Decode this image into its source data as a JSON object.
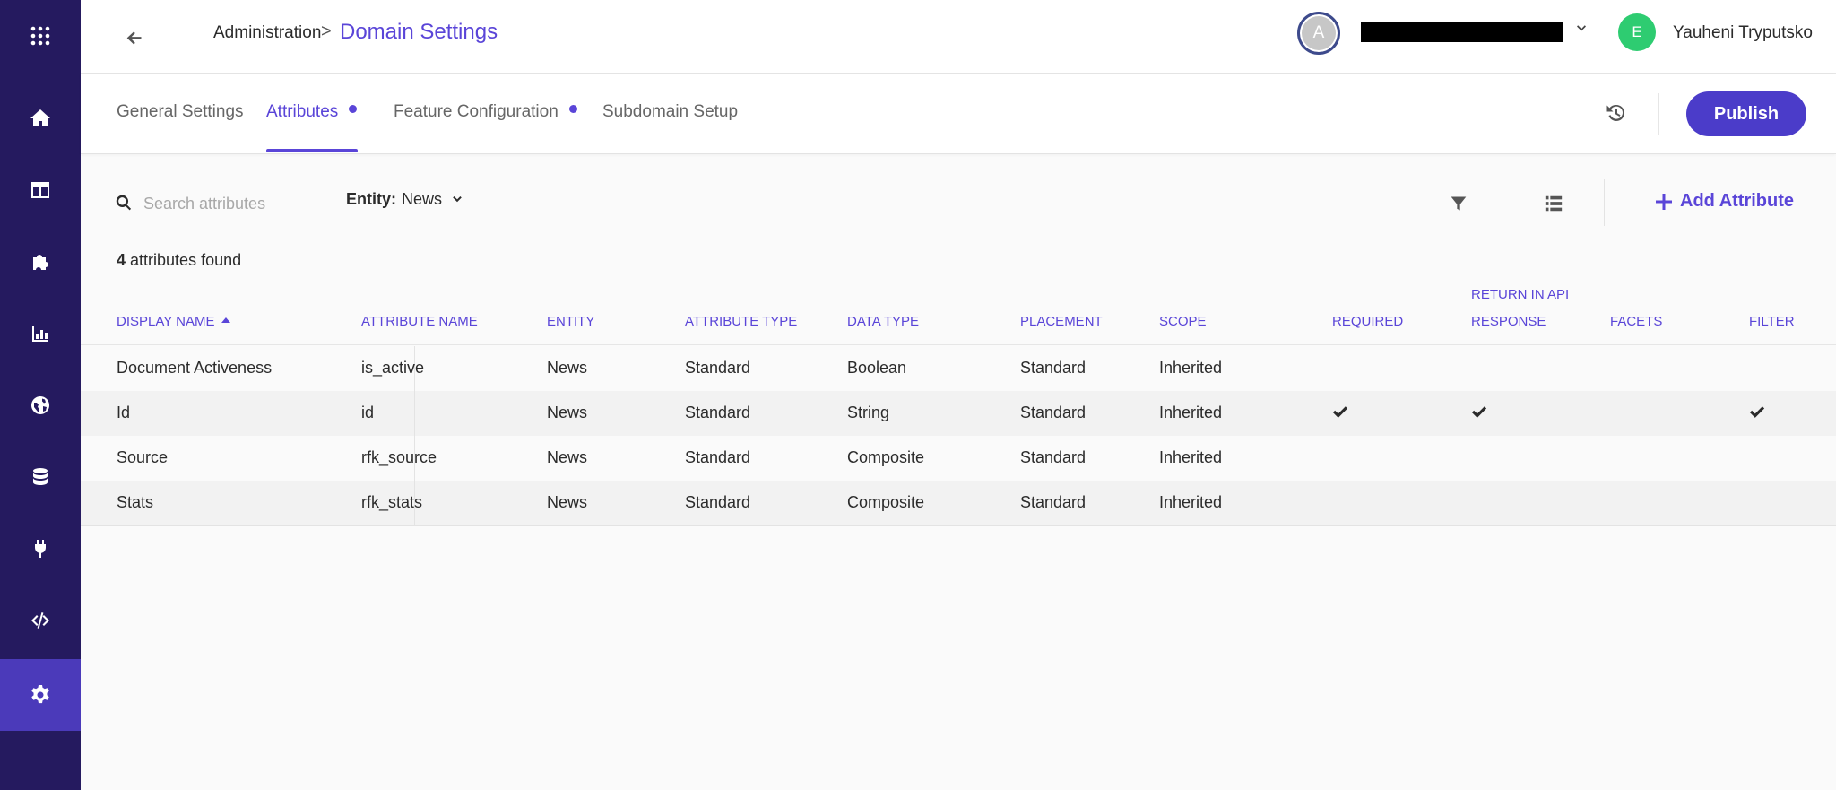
{
  "sidebar": {
    "items": [
      {
        "name": "apps-grid-icon"
      },
      {
        "name": "home-icon"
      },
      {
        "name": "layout-icon"
      },
      {
        "name": "puzzle-icon"
      },
      {
        "name": "analytics-icon"
      },
      {
        "name": "globe-icon"
      },
      {
        "name": "database-icon"
      },
      {
        "name": "plug-icon"
      },
      {
        "name": "code-icon"
      },
      {
        "name": "gear-icon",
        "active": true
      }
    ]
  },
  "header": {
    "breadcrumb_parent": "Administration",
    "breadcrumb_separator": ">",
    "page_title": "Domain Settings",
    "account_initial": "A",
    "user_initial": "E",
    "user_name": "Yauheni Tryputsko"
  },
  "tabs": [
    {
      "label": "General Settings",
      "active": false,
      "dot": false
    },
    {
      "label": "Attributes",
      "active": true,
      "dot": true
    },
    {
      "label": "Feature Configuration",
      "active": false,
      "dot": true
    },
    {
      "label": "Subdomain Setup",
      "active": false,
      "dot": false
    }
  ],
  "actions": {
    "publish_label": "Publish",
    "add_label": "Add Attribute"
  },
  "toolbar": {
    "search_placeholder": "Search attributes",
    "entity_label": "Entity:",
    "entity_value": "News"
  },
  "results": {
    "count": "4",
    "suffix": "attributes found"
  },
  "table": {
    "columns": [
      "Display Name",
      "Attribute Name",
      "Entity",
      "Attribute Type",
      "Data Type",
      "Placement",
      "Scope",
      "Required",
      "Return in API",
      "Response",
      "Facets",
      "Filter"
    ],
    "rows": [
      {
        "display_name": "Document Activeness",
        "attribute_name": "is_active",
        "entity": "News",
        "attribute_type": "Standard",
        "data_type": "Boolean",
        "placement": "Standard",
        "scope": "Inherited",
        "required": false,
        "return_in_api": false,
        "facets": false,
        "filter": false
      },
      {
        "display_name": "Id",
        "attribute_name": "id",
        "entity": "News",
        "attribute_type": "Standard",
        "data_type": "String",
        "placement": "Standard",
        "scope": "Inherited",
        "required": true,
        "return_in_api": true,
        "facets": false,
        "filter": true
      },
      {
        "display_name": "Source",
        "attribute_name": "rfk_source",
        "entity": "News",
        "attribute_type": "Standard",
        "data_type": "Composite",
        "placement": "Standard",
        "scope": "Inherited",
        "required": false,
        "return_in_api": false,
        "facets": false,
        "filter": false
      },
      {
        "display_name": "Stats",
        "attribute_name": "rfk_stats",
        "entity": "News",
        "attribute_type": "Standard",
        "data_type": "Composite",
        "placement": "Standard",
        "scope": "Inherited",
        "required": false,
        "return_in_api": false,
        "facets": false,
        "filter": false
      }
    ]
  },
  "colors": {
    "sidebar_bg": "#251a5f",
    "sidebar_active": "#4b3aba",
    "accent": "#5a45d8",
    "publish_bg": "#4b3cc9",
    "user_avatar": "#2ecc71"
  }
}
